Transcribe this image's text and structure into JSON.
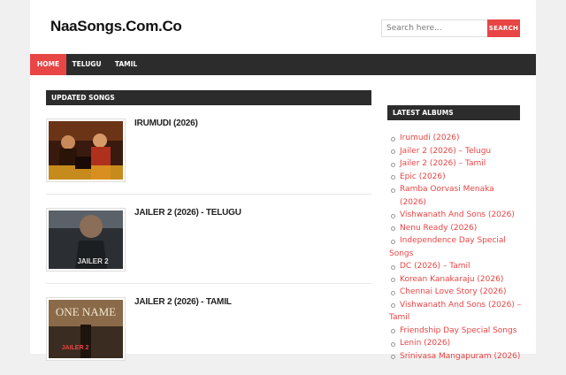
{
  "site": {
    "title": "NaaSongs.Com.Co"
  },
  "search": {
    "placeholder": "Search here...",
    "button": "SEARCH"
  },
  "nav": {
    "items": [
      "HOME",
      "TELUGU",
      "TAMIL"
    ]
  },
  "updated": {
    "heading": "UPDATED SONGS",
    "songs": [
      {
        "title": "IRUMUDI (2026)"
      },
      {
        "title": "JAILER 2 (2026) - TELUGU",
        "poster_text": "JAILER 2"
      },
      {
        "title": "JAILER 2 (2026) - TAMIL",
        "poster_text": "ONE NAME",
        "poster_sub": "JAILER 2"
      }
    ]
  },
  "sidebar": {
    "heading": "LATEST ALBUMS",
    "albums": [
      "Irumudi (2026)",
      "Jailer 2 (2026) – Telugu",
      "Jailer 2 (2026) – Tamil",
      "Epic (2026)",
      "Ramba Oorvasi Menaka (2026)",
      "Vishwanath And Sons (2026)",
      "Nenu Ready (2026)",
      "Independence Day Special",
      "Songs",
      "DC (2026) – Tamil",
      "Korean Kanakaraju (2026)",
      "Chennai Love Story (2026)",
      "Vishwanath And Sons (2026) –",
      "Tamil",
      "Friendship Day Special Songs",
      "Lenin (2026)",
      "Srinivasa Mangapuram (2026)"
    ]
  },
  "colors": {
    "accent": "#e84545",
    "dark": "#2c2c2c"
  }
}
